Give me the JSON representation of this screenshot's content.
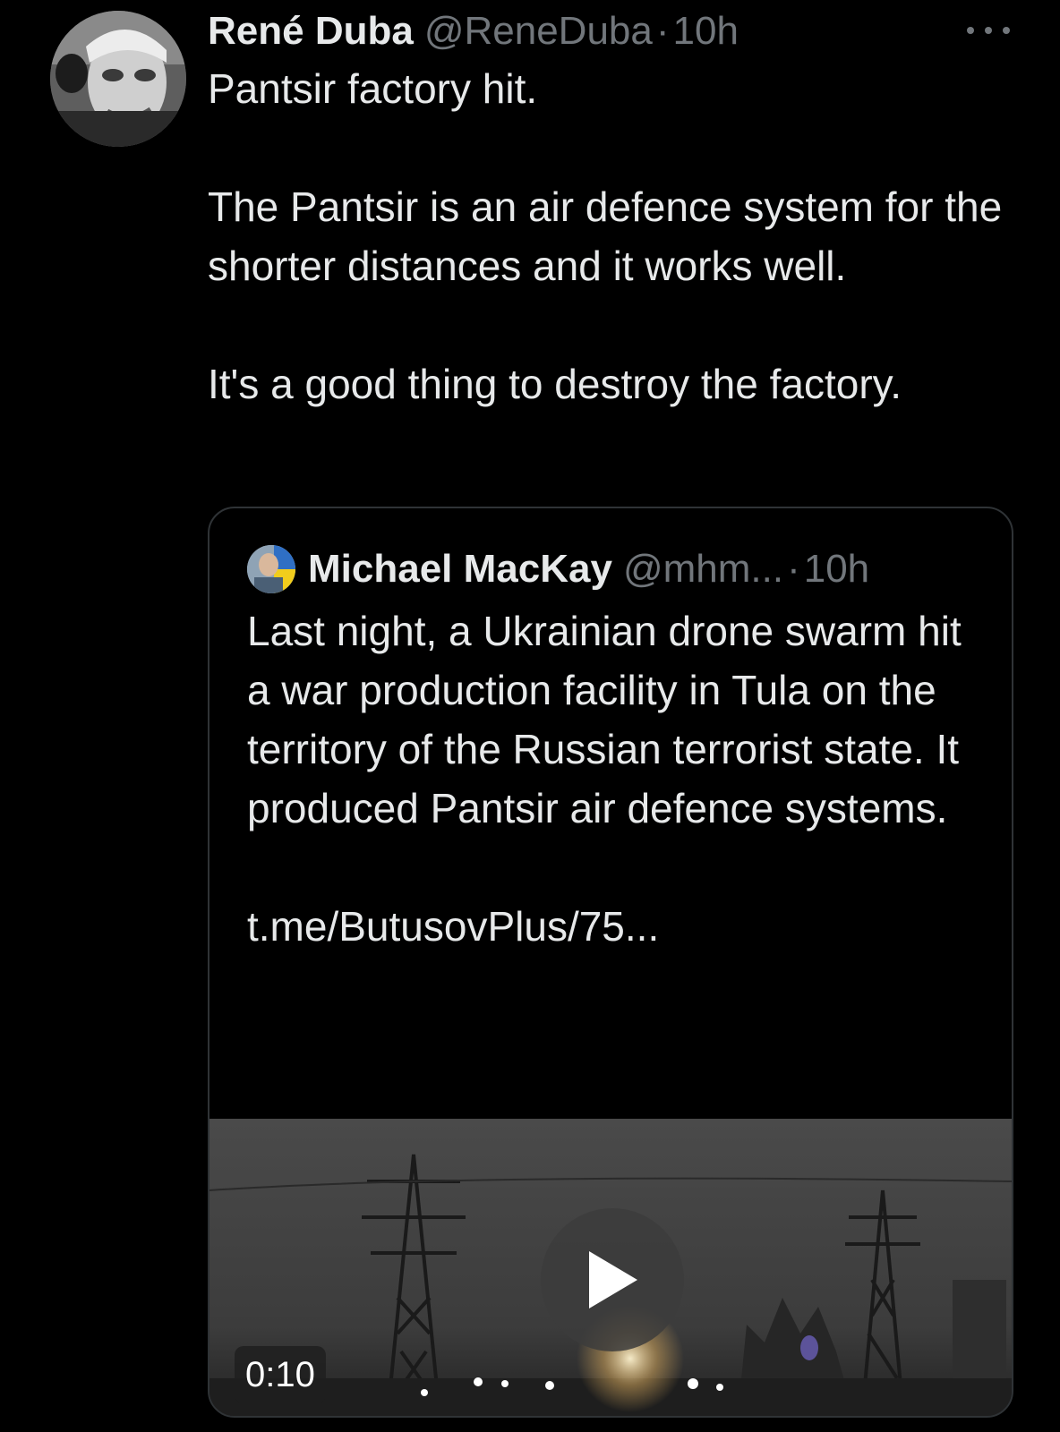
{
  "tweet": {
    "author_name": "René Duba",
    "author_handle": "@ReneDuba",
    "separator": "·",
    "timestamp": "10h",
    "paragraphs": [
      "Pantsir factory hit.",
      "The Pantsir is an air defence system for the shorter distances and it works well.",
      "It's a good thing to destroy the factory."
    ]
  },
  "quoted_tweet": {
    "author_name": "Michael MacKay",
    "author_handle": "@mhm...",
    "separator": "·",
    "timestamp": "10h",
    "text": "Last night, a Ukrainian drone swarm hit a war production facility in Tula on the territory of the Russian terrorist state. It produced Pantsir air defence systems.",
    "link": "t.me/ButusovPlus/75...",
    "video": {
      "duration": "0:10"
    }
  },
  "icons": {
    "more": "more-horizontal-icon",
    "play": "play-icon"
  },
  "colors": {
    "background": "#000000",
    "primary_text": "#e7e9ea",
    "secondary_text": "#71767b",
    "border": "#2f3336"
  }
}
